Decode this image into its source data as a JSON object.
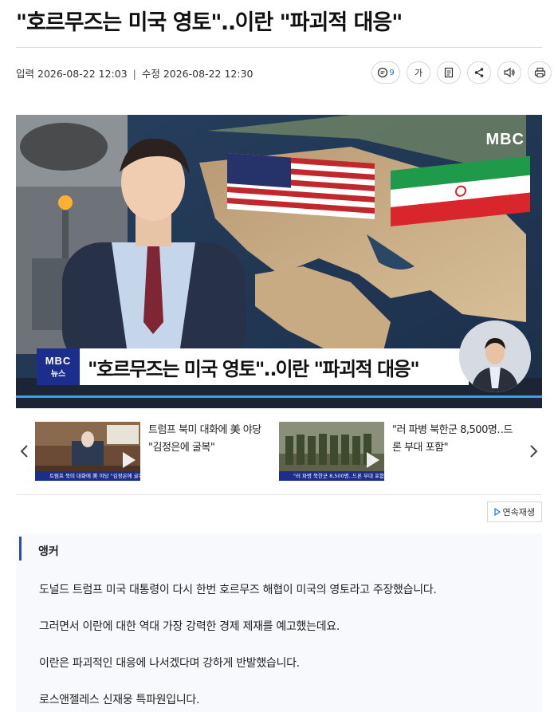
{
  "article": {
    "headline": "\"호르무즈는 미국 영토\"‥이란 \"파괴적 대응\"",
    "input_label": "입력",
    "input_time": "2026-08-22 12:03",
    "separator": "|",
    "edit_label": "수정",
    "edit_time": "2026-08-22 12:30"
  },
  "toolbar": {
    "comment_count": "9",
    "font_size_label": "가"
  },
  "video": {
    "broadcaster_logo": "MBC",
    "lower_third_logo_top": "MBC",
    "lower_third_logo_bottom": "뉴스",
    "lower_third_text": "\"호르무즈는 미국 영토\"‥이란 \"파괴적 대응\""
  },
  "related": {
    "items": [
      {
        "title": "트럼프 북미 대화에 美 야당 \"김정은에 굴복\"",
        "thumb_caption": "트럼프 북미 대화에 美 야당 \"김정은에 굴복\""
      },
      {
        "title": "\"러 파병 북한군 8,500명‥드론 부대 포함\"",
        "thumb_caption": "\"러 파병 북한군 8,500명‥드론 부대 포함\""
      }
    ]
  },
  "autoplay_label": "연속재생",
  "body": {
    "speaker": "앵커",
    "paragraphs": [
      "도널드 트럼프 미국 대통령이 다시 한번 호르무즈 해협이 미국의 영토라고 주장했습니다.",
      "그러면서 이란에 대한 역대 가장 강력한 경제 제재를 예고했는데요.",
      "이란은 파괴적인 대응에 나서겠다며 강하게 반발했습니다.",
      "로스앤젤레스 신재웅 특파원입니다."
    ]
  },
  "colors": {
    "accent": "#1c2e8c",
    "link_blue": "#1a73e8",
    "anchor_bar": "#2d4ea8"
  },
  "icons": [
    "comment-icon",
    "font-size-icon",
    "clip-icon",
    "share-icon",
    "speaker-icon",
    "print-icon",
    "chevron-left-icon",
    "chevron-right-icon",
    "play-icon"
  ]
}
